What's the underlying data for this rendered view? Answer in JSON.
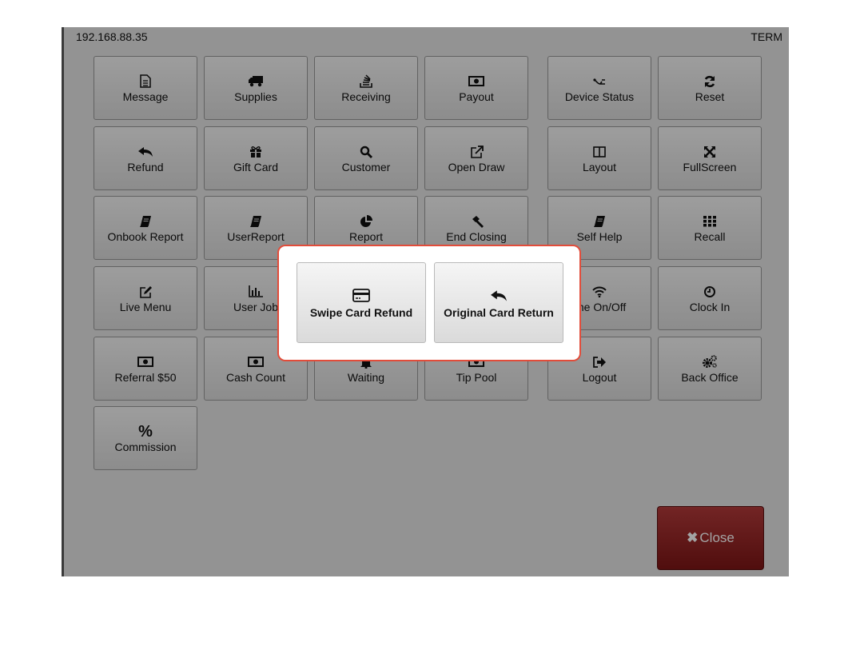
{
  "header": {
    "ip": "192.168.88.35",
    "terminal": "TERM"
  },
  "tiles": [
    {
      "label": "Message",
      "icon": "document-icon"
    },
    {
      "label": "Supplies",
      "icon": "truck-icon"
    },
    {
      "label": "Receiving",
      "icon": "stack-icon"
    },
    {
      "label": "Payout",
      "icon": "money-icon"
    },
    {
      "label": "Device Status",
      "icon": "plug-icon"
    },
    {
      "label": "Reset",
      "icon": "refresh-icon"
    },
    {
      "label": "Refund",
      "icon": "reply-icon"
    },
    {
      "label": "Gift Card",
      "icon": "gift-icon"
    },
    {
      "label": "Customer",
      "icon": "search-icon"
    },
    {
      "label": "Open Draw",
      "icon": "external-link-icon"
    },
    {
      "label": "Layout",
      "icon": "columns-icon"
    },
    {
      "label": "FullScreen",
      "icon": "expand-icon"
    },
    {
      "label": "Onbook Report",
      "icon": "book-icon"
    },
    {
      "label": "UserReport",
      "icon": "book-icon"
    },
    {
      "label": "Report",
      "icon": "pie-chart-icon"
    },
    {
      "label": "End Closing",
      "icon": "gavel-icon"
    },
    {
      "label": "Self Help",
      "icon": "book-icon"
    },
    {
      "label": "Recall",
      "icon": "grid-icon"
    },
    {
      "label": "Live Menu",
      "icon": "edit-icon"
    },
    {
      "label": "User Job",
      "icon": "bar-chart-icon"
    },
    {
      "label": "",
      "icon": ""
    },
    {
      "label": "",
      "icon": ""
    },
    {
      "label": "line On/Off",
      "icon": "wifi-icon"
    },
    {
      "label": "Clock In",
      "icon": "clock-icon"
    },
    {
      "label": "Referral $50",
      "icon": "money-icon"
    },
    {
      "label": "Cash Count",
      "icon": "money-icon"
    },
    {
      "label": "Waiting",
      "icon": "bell-icon"
    },
    {
      "label": "Tip Pool",
      "icon": "money-icon"
    },
    {
      "label": "Logout",
      "icon": "sign-out-icon"
    },
    {
      "label": "Back Office",
      "icon": "gears-icon"
    },
    {
      "label": "Commission",
      "icon": "percent-icon"
    }
  ],
  "close_button": {
    "label": "Close",
    "icon": "times-icon"
  },
  "dialog": {
    "options": [
      {
        "label": "Swipe Card Refund",
        "icon": "credit-card-icon"
      },
      {
        "label": "Original Card Return",
        "icon": "reply-icon"
      }
    ],
    "accent_color": "#e24c3a"
  }
}
